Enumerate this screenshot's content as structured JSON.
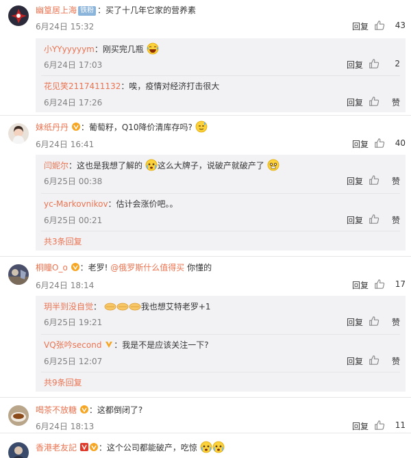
{
  "comments": [
    {
      "user": "幽篁居上海",
      "fan_badge": "铁粉",
      "text": "：买了十几年它家的营养素",
      "time": "6月24日 15:32",
      "reply": "回复",
      "likes": "43",
      "subs": [
        {
          "user": "小YYyyyyym",
          "text": "：刚买完几瓶",
          "time": "6月24日 17:03",
          "reply": "回复",
          "likes": "2"
        },
        {
          "user": "花见笑2117411132",
          "text": "：唉，疫情对经济打击很大",
          "time": "6月24日 17:26",
          "reply": "回复",
          "likes": "赞"
        }
      ]
    },
    {
      "user": "妹纸丹丹",
      "text": "：葡萄籽，Q10降价清库存吗?",
      "time": "6月24日 16:41",
      "reply": "回复",
      "likes": "40",
      "subs": [
        {
          "user": "闫妮尔",
          "text_a": "：这也是我想了解的",
          "text_b": "这么大牌子，说破产就破产了",
          "time": "6月25日 00:38",
          "reply": "回复",
          "likes": "赞"
        },
        {
          "user": "yc-Markovnikov",
          "text": "：估计会涨价吧。。",
          "time": "6月25日 00:21",
          "reply": "回复",
          "likes": "赞"
        }
      ],
      "more": "共3条回复"
    },
    {
      "user": "桐瞳O_o",
      "text": "：老罗!",
      "mention": "@俄罗斯什么值得买",
      "text_after": " 你懂的",
      "time": "6月24日 18:14",
      "reply": "回复",
      "likes": "17",
      "subs": [
        {
          "user": "玥半到没自觉",
          "text_pre": "：",
          "text": "我也想艾特老罗+1",
          "time": "6月25日 19:21",
          "reply": "回复",
          "likes": "赞"
        },
        {
          "user": "VQ张吟second",
          "text": "：我是不是应该关注一下?",
          "time": "6月25日 12:07",
          "reply": "回复",
          "likes": "赞"
        }
      ],
      "more": "共9条回复"
    },
    {
      "user": "喝茶不放糖",
      "text": "：这都倒闭了?",
      "time": "6月24日 18:13",
      "reply": "回复",
      "likes": "11"
    },
    {
      "user": "香港老友記",
      "text": "：这个公司都能破产，吃惊"
    }
  ],
  "colors": {
    "username": "#eb7350",
    "sub_bg": "#f2f2f5",
    "meta": "#808080",
    "fan_badge": "#8ab4da",
    "vip": "#f6a623"
  },
  "icons": [
    "thumb-up-icon",
    "laugh-emoji",
    "sweat-emoji",
    "shocked-emoji",
    "clap-emoji",
    "vip-badge-icon",
    "fan-badge"
  ]
}
